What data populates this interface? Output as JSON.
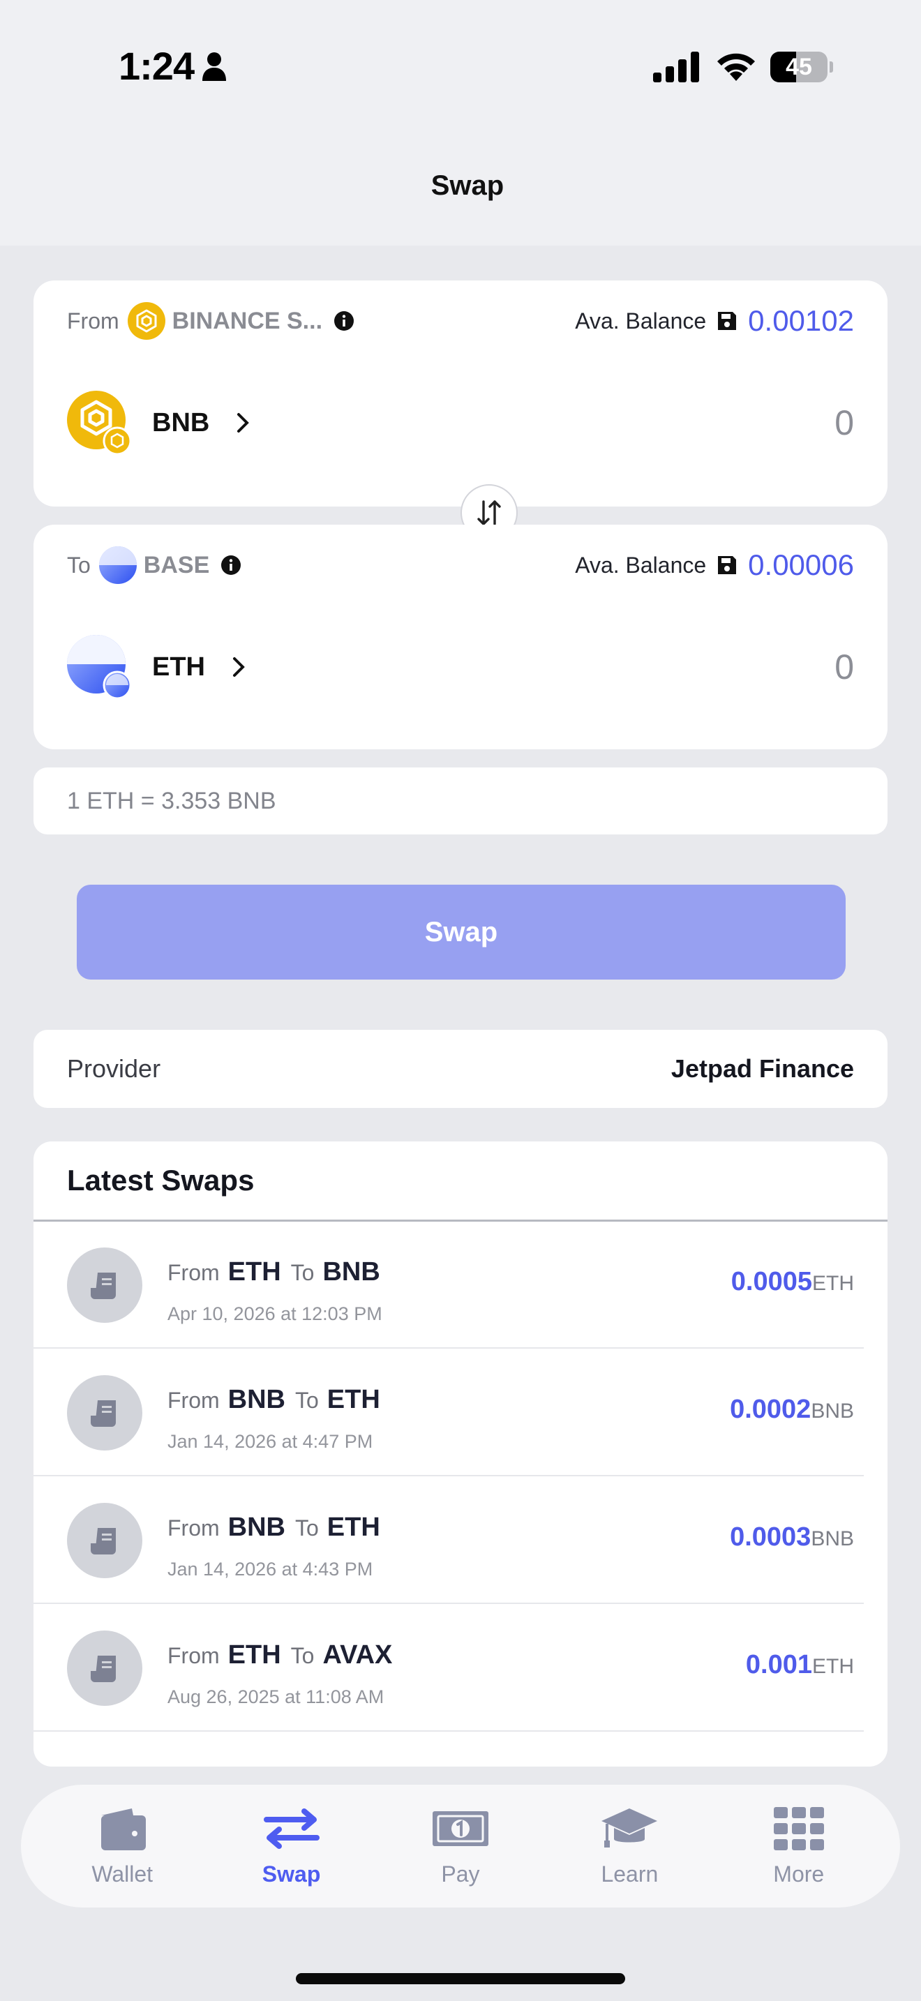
{
  "status_bar": {
    "time": "1:24",
    "battery": "45",
    "battery_level": 0.45
  },
  "header": {
    "title": "Swap"
  },
  "from_card": {
    "label": "From",
    "chain": "BINANCE S...",
    "balance_label": "Ava. Balance",
    "balance": "0.00102",
    "token": "BNB",
    "amount_placeholder": "0"
  },
  "to_card": {
    "label": "To",
    "chain": "BASE",
    "balance_label": "Ava. Balance",
    "balance": "0.00006",
    "token": "ETH",
    "amount_placeholder": "0"
  },
  "rate": "1 ETH = 3.353 BNB",
  "swap_button": "Swap",
  "provider": {
    "label": "Provider",
    "value": "Jetpad Finance"
  },
  "latest_swaps": {
    "title": "Latest Swaps",
    "items": [
      {
        "from_word": "From",
        "from_token": "ETH",
        "to_word": "To",
        "to_token": "BNB",
        "date": "Apr 10, 2026 at 12:03 PM",
        "amount": "0.0005",
        "unit": "ETH"
      },
      {
        "from_word": "From",
        "from_token": "BNB",
        "to_word": "To",
        "to_token": "ETH",
        "date": "Jan 14, 2026 at 4:47 PM",
        "amount": "0.0002",
        "unit": "BNB"
      },
      {
        "from_word": "From",
        "from_token": "BNB",
        "to_word": "To",
        "to_token": "ETH",
        "date": "Jan 14, 2026 at 4:43 PM",
        "amount": "0.0003",
        "unit": "BNB"
      },
      {
        "from_word": "From",
        "from_token": "ETH",
        "to_word": "To",
        "to_token": "AVAX",
        "date": "Aug 26, 2025 at 11:08 AM",
        "amount": "0.001",
        "unit": "ETH"
      }
    ]
  },
  "tabbar": {
    "tabs": [
      {
        "label": "Wallet",
        "icon": "wallet-icon"
      },
      {
        "label": "Swap",
        "icon": "swap-arrows-icon",
        "active": true
      },
      {
        "label": "Pay",
        "icon": "banknote-icon"
      },
      {
        "label": "Learn",
        "icon": "graduation-cap-icon"
      },
      {
        "label": "More",
        "icon": "grid-icon"
      }
    ]
  },
  "colors": {
    "accent": "#4f5bea",
    "swap_button_bg": "#97a0f1",
    "page_bg": "#e8e9ed",
    "bnb_yellow": "#f0b90b",
    "base_blue": "#3f63f0"
  }
}
